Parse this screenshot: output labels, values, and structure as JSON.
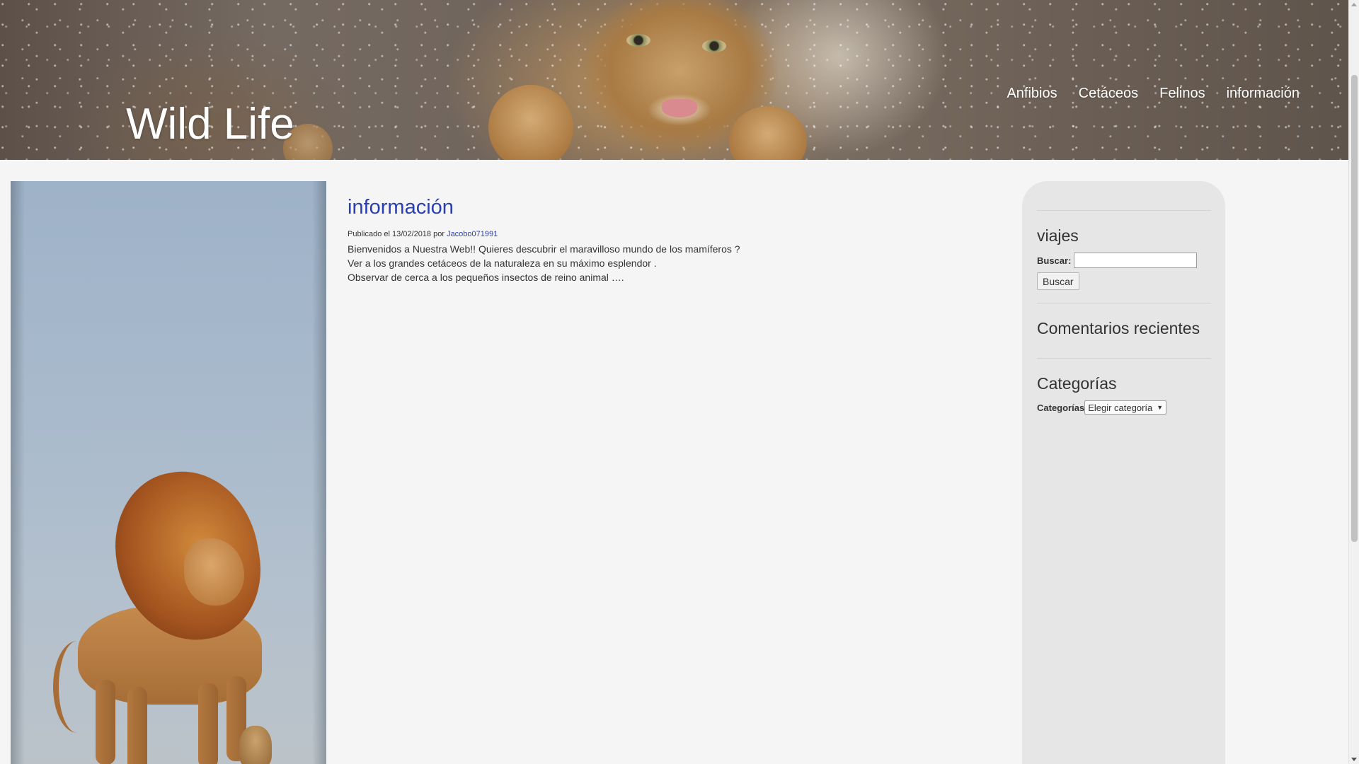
{
  "site": {
    "title": "Wild Life"
  },
  "nav": {
    "items": [
      {
        "label": "Anfibios"
      },
      {
        "label": "Cetáceos"
      },
      {
        "label": "Felinos"
      },
      {
        "label": "información"
      }
    ]
  },
  "article": {
    "title": "información",
    "meta_prefix": "Publicado el 13/02/2018 por",
    "author": "Jacobo071991",
    "paragraphs": [
      "Bienvenidos a Nuestra Web!! Quieres descubrir el maravilloso mundo de los mamíferos ?",
      "Ver a los grandes cetáceos de la naturaleza en su máximo esplendor .",
      "Observar de cerca a los pequeños insectos de reino animal …."
    ]
  },
  "sidebar": {
    "search_widget": {
      "title": "viajes",
      "label": "Buscar:",
      "value": "",
      "button": "Buscar"
    },
    "comments_widget": {
      "title": "Comentarios recientes"
    },
    "categories_widget": {
      "title": "Categorías",
      "label": "Categorías",
      "selected": "Elegir categoría"
    }
  },
  "icons": {
    "dropdown": "chevron-down-icon",
    "scroll_up": "arrow-up-icon",
    "scroll_down": "arrow-down-icon"
  }
}
